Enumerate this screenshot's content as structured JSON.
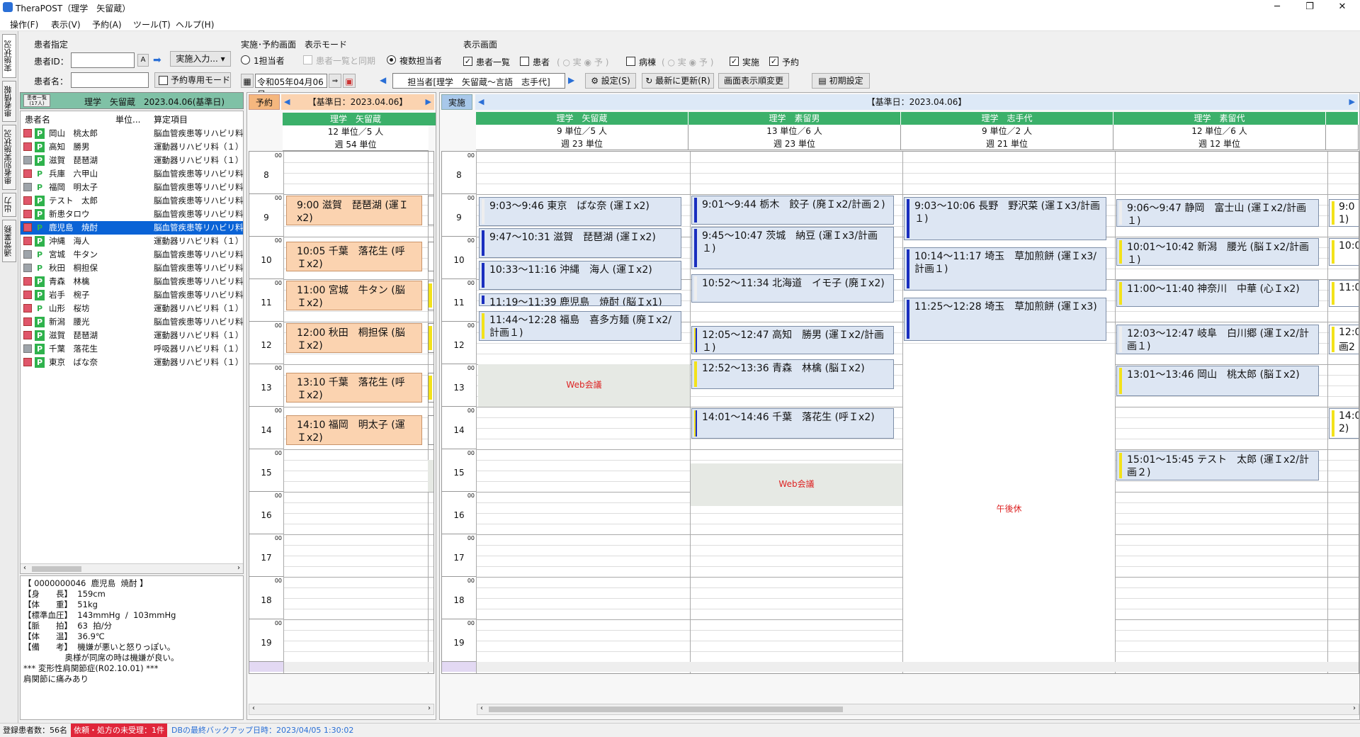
{
  "window": {
    "title": "TheraPOST（理学　矢留蔵）"
  },
  "menu": [
    "操作(F)",
    "表示(V)",
    "予約(A)",
    "ツール(T)",
    "ヘルプ(H)"
  ],
  "side_tabs": [
    "実施状況",
    "患者情報",
    "患者別実施状況",
    "出力",
    "通常業務"
  ],
  "patient_select": {
    "group_label": "患者指定",
    "id_label": "患者ID：",
    "name_label": "患者名：",
    "id_value": "",
    "name_value": "",
    "a_btn": "A",
    "input_btn": "実施入力...",
    "reserve_mode": "予約専用モード"
  },
  "mode": {
    "group_label": "実施･予約画面　表示モード",
    "single": "1担当者",
    "sync": "患者一覧と同期",
    "multi": "複数担当者"
  },
  "display": {
    "group_label": "表示画面",
    "patient_list": "患者一覧",
    "patient": "患者",
    "ward": "病棟",
    "done": "実施",
    "reserve": "予約",
    "sub_done": "実",
    "sub_plan": "予"
  },
  "date_value": "令和05年04月06日",
  "assignees": "担当者[理学　矢留蔵～言語　志手代]",
  "buttons": {
    "settings": "設定(S)",
    "refresh": "最新に更新(R)",
    "order": "画面表示順変更",
    "init": "初期設定"
  },
  "left_tab": {
    "small": "患者一覧\n(17人)",
    "label": "理学　矢留蔵　2023.04.06(基準日)"
  },
  "plist_headers": [
    "患者名",
    "単位...",
    "算定項目"
  ],
  "patients": [
    {
      "name": "岡山　桃太郎",
      "cat": "脳血管疾患等リハビリ料（",
      "g": false,
      "p": true
    },
    {
      "name": "高知　勝男",
      "cat": "運動器リハビリ料（１）",
      "g": false,
      "p": true
    },
    {
      "name": "滋賀　琵琶湖",
      "cat": "運動器リハビリ料（１）",
      "g": true,
      "p": true
    },
    {
      "name": "兵庫　六甲山",
      "cat": "脳血管疾患等リハビリ料（",
      "g": false,
      "p": false
    },
    {
      "name": "福岡　明太子",
      "cat": "脳血管疾患等リハビリ料（",
      "g": true,
      "p": false
    },
    {
      "name": "テスト　太郎",
      "cat": "脳血管疾患等リハビリ料（",
      "g": false,
      "p": true
    },
    {
      "name": "新患タロウ",
      "cat": "脳血管疾患等リハビリ料（",
      "g": false,
      "p": true
    },
    {
      "name": "鹿児島　焼酎",
      "cat": "脳血管疾患等リハビリ料（",
      "g": false,
      "p": false,
      "sel": true
    },
    {
      "name": "沖縄　海人",
      "cat": "運動器リハビリ料（１）",
      "g": false,
      "p": true
    },
    {
      "name": "宮城　牛タン",
      "cat": "脳血管疾患等リハビリ料（",
      "g": true,
      "p": false
    },
    {
      "name": "秋田　桐担保",
      "cat": "脳血管疾患等リハビリ料（",
      "g": true,
      "p": false
    },
    {
      "name": "青森　林檎",
      "cat": "脳血管疾患等リハビリ料（",
      "g": false,
      "p": true
    },
    {
      "name": "岩手　椀子",
      "cat": "脳血管疾患等リハビリ料（",
      "g": false,
      "p": true
    },
    {
      "name": "山形　桜坊",
      "cat": "運動器リハビリ料（１）",
      "g": false,
      "p": false
    },
    {
      "name": "新潟　腰光",
      "cat": "脳血管疾患等リハビリ料（",
      "g": false,
      "p": true
    },
    {
      "name": "滋賀　琵琶湖",
      "cat": "運動器リハビリ料（１）",
      "g": false,
      "p": true
    },
    {
      "name": "千葉　落花生",
      "cat": "呼吸器リハビリ料（１）",
      "g": true,
      "p": true
    },
    {
      "name": "東京　ばな奈",
      "cat": "運動器リハビリ料（１）",
      "g": false,
      "p": true
    }
  ],
  "pinfo": "【 0000000046  鹿児島  焼酎 】\n【身　　長】  159cm\n【体　　重】  51kg\n【標準血圧】  143mmHg  /  103mmHg\n【脈　　拍】  63  拍/分\n【体　　温】  36.9℃\n【備　　考】  機嫌が悪いと怒りっぽい。\n                奥様が同席の時は機嫌が良い。\n*** 変形性肩関節症(R02.10.01) ***\n肩関節に痛みあり",
  "reserve_panel": {
    "tab": "予約",
    "date": "【基準日：2023.04.06】",
    "staff": "理学　矢留蔵",
    "units": "12 単位／5 人",
    "week": "週 54 単位"
  },
  "done_panel": {
    "tab": "実施",
    "date": "【基準日：2023.04.06】"
  },
  "hours": [
    "8",
    "9",
    "10",
    "11",
    "12",
    "13",
    "14",
    "15",
    "16",
    "17",
    "18",
    "19"
  ],
  "staff": [
    {
      "name": "理学　矢留蔵",
      "units": "9 単位／5 人",
      "week": "週 23 単位"
    },
    {
      "name": "理学　素留男",
      "units": "13 単位／6 人",
      "week": "週 23 単位"
    },
    {
      "name": "理学　志手代",
      "units": "9 単位／2 人",
      "week": "週 21 単位"
    },
    {
      "name": "理学　素留代",
      "units": "12 単位／6 人",
      "week": "週 12 単位"
    }
  ],
  "reservations": [
    "9:00 滋賀　琵琶湖 (運Ｉx2)",
    "10:05 千葉　落花生 (呼Ｉx2)",
    "11:00 宮城　牛タン (脳Ｉx2)",
    "12:00 秋田　桐担保 (脳Ｉx2)",
    "13:10 千葉　落花生 (呼Ｉx2)",
    "14:10 福岡　明太子 (運Ｉx2)"
  ],
  "appts": {
    "c0": [
      "9:03～9:46 東京　ばな奈 (運Ｉx2)",
      "9:47～10:31 滋賀　琵琶湖 (運Ｉx2)",
      "10:33～11:16 沖縄　海人 (運Ｉx2)",
      "11:19～11:39 鹿児島　焼酎 (脳Ｉx1)",
      "11:44～12:28 福島　喜多方麺 (廃Ｉx2/計画１)"
    ],
    "c1": [
      "9:01～9:44 栃木　餃子 (廃Ｉx2/計画２)",
      "9:45～10:47 茨城　納豆 (運Ｉx3/計画１)",
      "10:52～11:34 北海道　イモ子 (廃Ｉx2)",
      "12:05～12:47 高知　勝男 (運Ｉx2/計画１)",
      "12:52～13:36 青森　林檎 (脳Ｉx2)",
      "14:01～14:46 千葉　落花生 (呼Ｉx2)"
    ],
    "c2": [
      "9:03～10:06 長野　野沢菜 (運Ｉx3/計画１)",
      "10:14～11:17 埼玉　草加煎餅 (運Ｉx3/計画１)",
      "11:25～12:28 埼玉　草加煎餅 (運Ｉx3)"
    ],
    "c3": [
      "9:06～9:47 静岡　富士山 (運Ｉx2/計画１)",
      "10:01～10:42 新潟　腰光 (脳Ｉx2/計画１)",
      "11:00～11:40 神奈川　中華 (心Ｉx2)",
      "12:03～12:47 岐阜　白川郷 (運Ｉx2/計画１)",
      "13:01～13:46 岡山　桃太郎 (脳Ｉx2)",
      "15:01～15:45 テスト　太郎 (運Ｉx2/計画２)"
    ],
    "c4": [
      "9:0",
      "1)",
      "10:0",
      "11:0",
      "12:0",
      "画2",
      "14:0",
      "2)"
    ]
  },
  "labels": {
    "web": "Web会議",
    "afternoon_off": "午後休"
  },
  "status": {
    "count": "登録患者数：56名",
    "alert": "依頼・処方の未受理：1件",
    "backup": "DBの最終バックアップ日時：2023/04/05 1:30:02"
  },
  "colors": {
    "green": "#3bb06a",
    "reserve": "#fbd3b0",
    "appt": "#dde6f3",
    "alert": "#e0263a"
  }
}
